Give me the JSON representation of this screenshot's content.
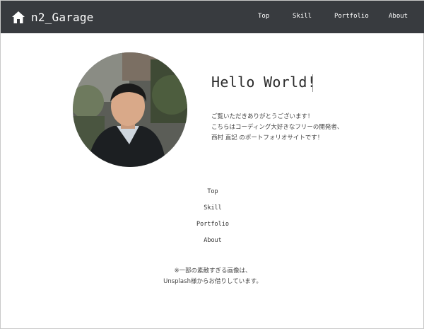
{
  "header": {
    "brand": "n2_Garage",
    "brand_icon": "home-icon",
    "nav": [
      "Top",
      "Skill",
      "Portfolio",
      "About"
    ]
  },
  "hero": {
    "headline": "Hello World!",
    "intro": [
      "ご覧いただきありがとうございます！",
      "こちらはコーディング大好きなフリーの開発者、",
      "西村 直記 のポートフォリオサイトです！"
    ]
  },
  "footer_nav": [
    "Top",
    "Skill",
    "Portfolio",
    "About"
  ],
  "credit": [
    "※一部の素敵すぎる画像は、",
    "Unsplash様からお借りしています。"
  ],
  "colors": {
    "header_bg": "#383b3f",
    "header_text": "#ffffff",
    "page_bg": "#ffffff"
  }
}
